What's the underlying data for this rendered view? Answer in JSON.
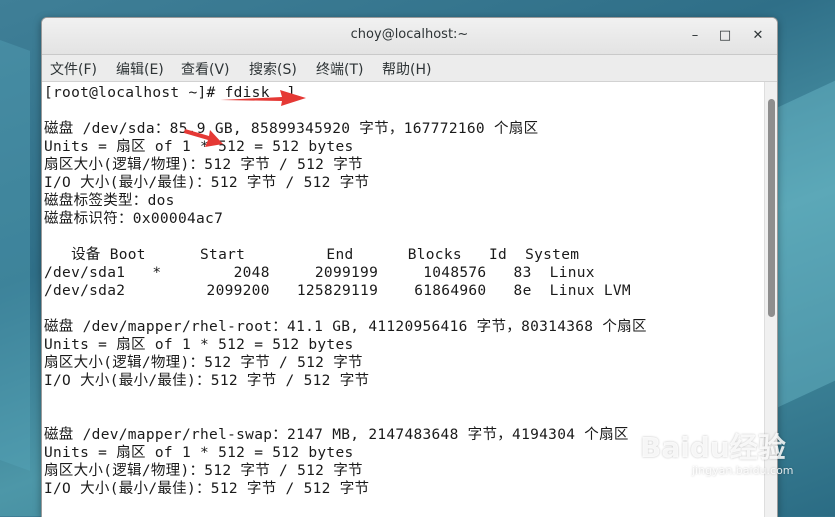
{
  "window": {
    "title": "choy@localhost:~",
    "controls": {
      "minimize": "–",
      "maximize": "□",
      "close": "✕"
    }
  },
  "menu": [
    "文件(F)",
    "编辑(E)",
    "查看(V)",
    "搜索(S)",
    "终端(T)",
    "帮助(H)"
  ],
  "terminal": {
    "lines": [
      "[root@localhost ~]# fdisk -l",
      "",
      "磁盘 /dev/sda：85.9 GB, 85899345920 字节，167772160 个扇区",
      "Units = 扇区 of 1 * 512 = 512 bytes",
      "扇区大小(逻辑/物理)：512 字节 / 512 字节",
      "I/O 大小(最小/最佳)：512 字节 / 512 字节",
      "磁盘标签类型：dos",
      "磁盘标识符：0x00004ac7",
      "",
      "   设备 Boot      Start         End      Blocks   Id  System",
      "/dev/sda1   *        2048     2099199     1048576   83  Linux",
      "/dev/sda2         2099200   125829119    61864960   8e  Linux LVM",
      "",
      "磁盘 /dev/mapper/rhel-root：41.1 GB, 41120956416 字节，80314368 个扇区",
      "Units = 扇区 of 1 * 512 = 512 bytes",
      "扇区大小(逻辑/物理)：512 字节 / 512 字节",
      "I/O 大小(最小/最佳)：512 字节 / 512 字节",
      "",
      "",
      "磁盘 /dev/mapper/rhel-swap：2147 MB, 2147483648 字节，4194304 个扇区",
      "Units = 扇区 of 1 * 512 = 512 bytes",
      "扇区大小(逻辑/物理)：512 字节 / 512 字节",
      "I/O 大小(最小/最佳)：512 字节 / 512 字节"
    ]
  },
  "scrollbar": {
    "position": 0.08
  },
  "watermark": {
    "brand": "Baidu经验",
    "url": "jingyan.baidu.com"
  },
  "colors": {
    "annotation_arrow": "#e53935",
    "terminal_bg": "#ffffff",
    "terminal_fg": "#1a1a1a"
  }
}
